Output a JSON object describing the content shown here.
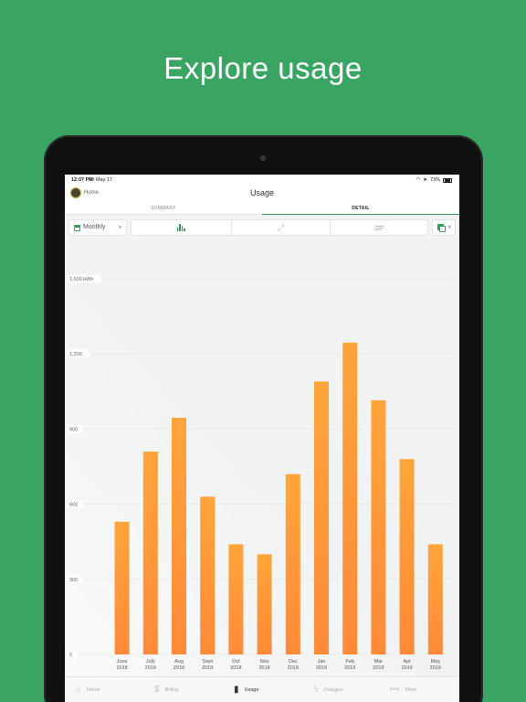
{
  "headline": "Explore usage",
  "status": {
    "time": "12:07 PM",
    "date": "Fri May 17",
    "battery": "73%"
  },
  "header": {
    "home": "Home",
    "title": "Usage"
  },
  "tabs": [
    {
      "label": "SUMMARY"
    },
    {
      "label": "DETAIL"
    }
  ],
  "toolbar": {
    "period": "Monthly"
  },
  "nav": [
    {
      "label": "Home",
      "icon": "home-icon"
    },
    {
      "label": "Billing",
      "icon": "dollar-icon"
    },
    {
      "label": "Usage",
      "icon": "bar-chart-icon"
    },
    {
      "label": "Outages",
      "icon": "lightning-icon"
    },
    {
      "label": "More",
      "icon": "more-icon"
    }
  ],
  "colors": {
    "background": "#3aa562",
    "accent": "#2aa65a",
    "bar_top": "#ffa53a",
    "bar_bottom": "#ff8a3a"
  },
  "chart_data": {
    "type": "bar",
    "categories": [
      [
        "June",
        "2018"
      ],
      [
        "July",
        "2018"
      ],
      [
        "Aug",
        "2018"
      ],
      [
        "Sept",
        "2018"
      ],
      [
        "Oct",
        "2018"
      ],
      [
        "Nov",
        "2018"
      ],
      [
        "Dec",
        "2018"
      ],
      [
        "Jan",
        "2019"
      ],
      [
        "Feb",
        "2019"
      ],
      [
        "Mar",
        "2019"
      ],
      [
        "Apr",
        "2019"
      ],
      [
        "May",
        "2019"
      ]
    ],
    "values": [
      530,
      810,
      945,
      630,
      440,
      400,
      720,
      1090,
      1245,
      1015,
      780,
      440
    ],
    "ylim": [
      0,
      1500
    ],
    "yticks": [
      {
        "value": 0,
        "label": "0"
      },
      {
        "value": 300,
        "label": "300"
      },
      {
        "value": 600,
        "label": "600"
      },
      {
        "value": 900,
        "label": "900"
      },
      {
        "value": 1200,
        "label": "1,200"
      },
      {
        "value": 1500,
        "label": "1,500 kWh"
      }
    ],
    "grid": true
  }
}
